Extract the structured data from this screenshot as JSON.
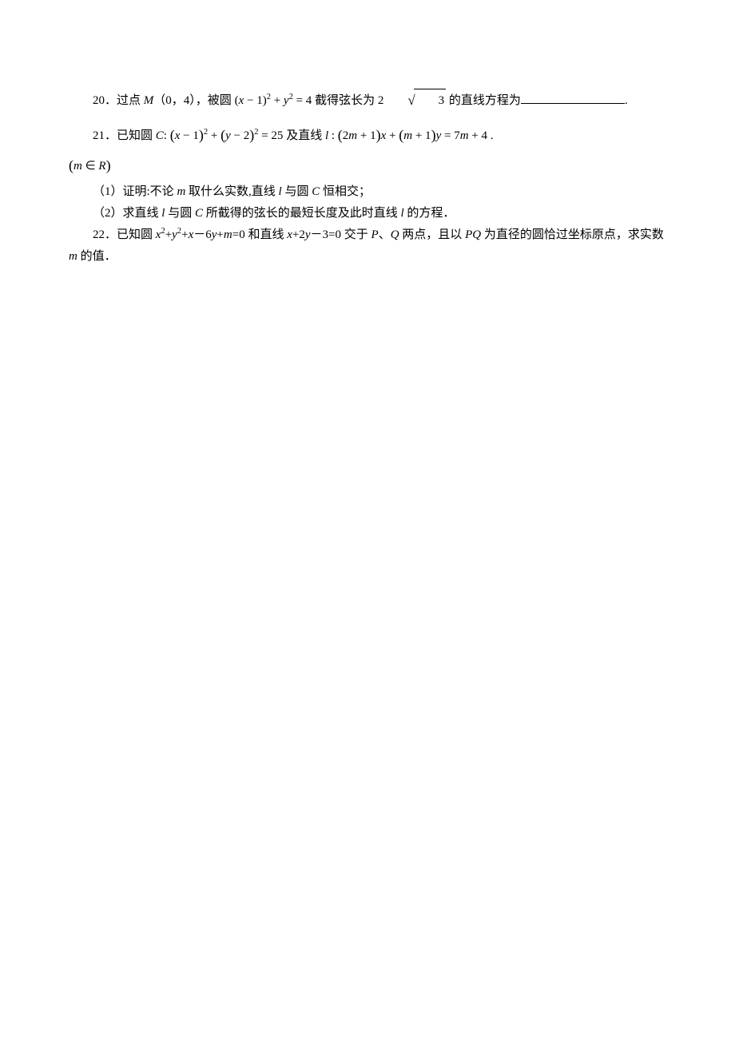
{
  "q20": {
    "num": "20．",
    "t1": "过点 ",
    "pointName": "M",
    "point": "（0，4），",
    "t2": "被圆 ",
    "eq_a": "(",
    "eq_x": "x",
    "eq_b": " − 1)",
    "eq_exp1": "2",
    "eq_c": " + ",
    "eq_y": "y",
    "eq_exp2": "2",
    "eq_d": " = 4",
    "t3": " 截得弦长为 ",
    "coef": "2",
    "radicand": "3",
    "t4": " 的直线方程为",
    "period": "."
  },
  "q21": {
    "num": "21．",
    "t1": "已知圆 ",
    "C": "C",
    "colon1": ": ",
    "lp1": "(",
    "x1": "x",
    "mid1": " − 1",
    "rp1": ")",
    "exp1": "2",
    "plus1": " + ",
    "lp2": "(",
    "y1": "y",
    "mid2": " − 2",
    "rp2": ")",
    "exp2": "2",
    "eq25": " = 25",
    "t2": " 及直线 ",
    "l": "l",
    "colon2": " : ",
    "lp3": "(",
    "coef1a": "2",
    "m1": "m",
    "coef1b": " + 1",
    "rp3": ")",
    "x2": "x",
    "plus2": " + ",
    "lp4": "(",
    "m2": "m",
    "coef2": " + 1",
    "rp4": ")",
    "y2": "y",
    "eqr": " = 7",
    "m3": "m",
    "plus4": " + 4",
    "dot": " .",
    "cond_lp": "(",
    "cond_m": "m",
    "cond_in": " ∈ ",
    "cond_R": "R",
    "cond_rp": ")",
    "sub1_n": "（1）",
    "sub1_a": "证明:不论 ",
    "sub1_m": "m",
    "sub1_b": " 取什么实数,直线 ",
    "sub1_l": "l",
    "sub1_c": " 与圆 ",
    "sub1_C": "C",
    "sub1_d": " 恒相交；",
    "sub2_n": "（2）",
    "sub2_a": "求直线 ",
    "sub2_l": "l",
    "sub2_b": " 与圆 ",
    "sub2_C": "C",
    "sub2_c": " 所截得的弦长的最短长度及此时直线 ",
    "sub2_l2": "l",
    "sub2_d": " 的方程．"
  },
  "q22": {
    "num": "22．",
    "t1": "已知圆 ",
    "x": "x",
    "e1": "2",
    "p1": "+",
    "y": "y",
    "e2": "2",
    "p2": "+",
    "x2": "x",
    "m6": "－6",
    "y2": "y",
    "pm": "+",
    "m": "m",
    "eq0": "=0 ",
    "t2": "和直线 ",
    "x3": "x",
    "p2y": "+2",
    "y3": "y",
    "m3": "－3=0 ",
    "t3": "交于 ",
    "P": "P",
    "sep": "、",
    "Q": "Q",
    "t4": " 两点，且以 ",
    "PQ": "PQ",
    "t5": " 为直径的圆恰过坐标原点，求实数 ",
    "m2": "m",
    "t6": " 的值．"
  }
}
